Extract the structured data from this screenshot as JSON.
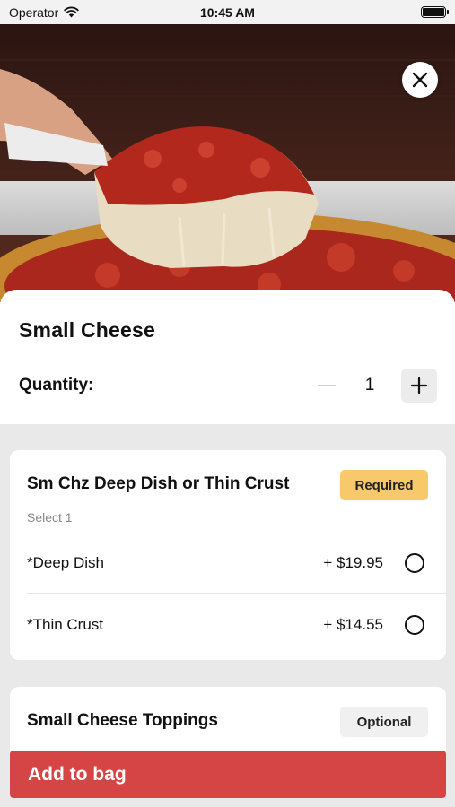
{
  "status_bar": {
    "carrier": "Operator",
    "time": "10:45 AM"
  },
  "hero": {
    "image": "deep-dish-cheese-pizza-slice"
  },
  "product": {
    "title": "Small Cheese"
  },
  "quantity": {
    "label": "Quantity:",
    "value": "1"
  },
  "groups": [
    {
      "title": "Sm Chz Deep Dish or Thin Crust",
      "badge": "Required",
      "subtitle": "Select 1",
      "options": [
        {
          "name": "*Deep Dish",
          "price": "+ $19.95"
        },
        {
          "name": "*Thin Crust",
          "price": "+ $14.55"
        }
      ]
    },
    {
      "title": "Small Cheese Toppings",
      "badge": "Optional"
    }
  ],
  "cta": {
    "label": "Add to bag"
  },
  "colors": {
    "primary": "#d64545",
    "required_badge": "#f7c96b",
    "optional_badge": "#f0f0f0"
  }
}
